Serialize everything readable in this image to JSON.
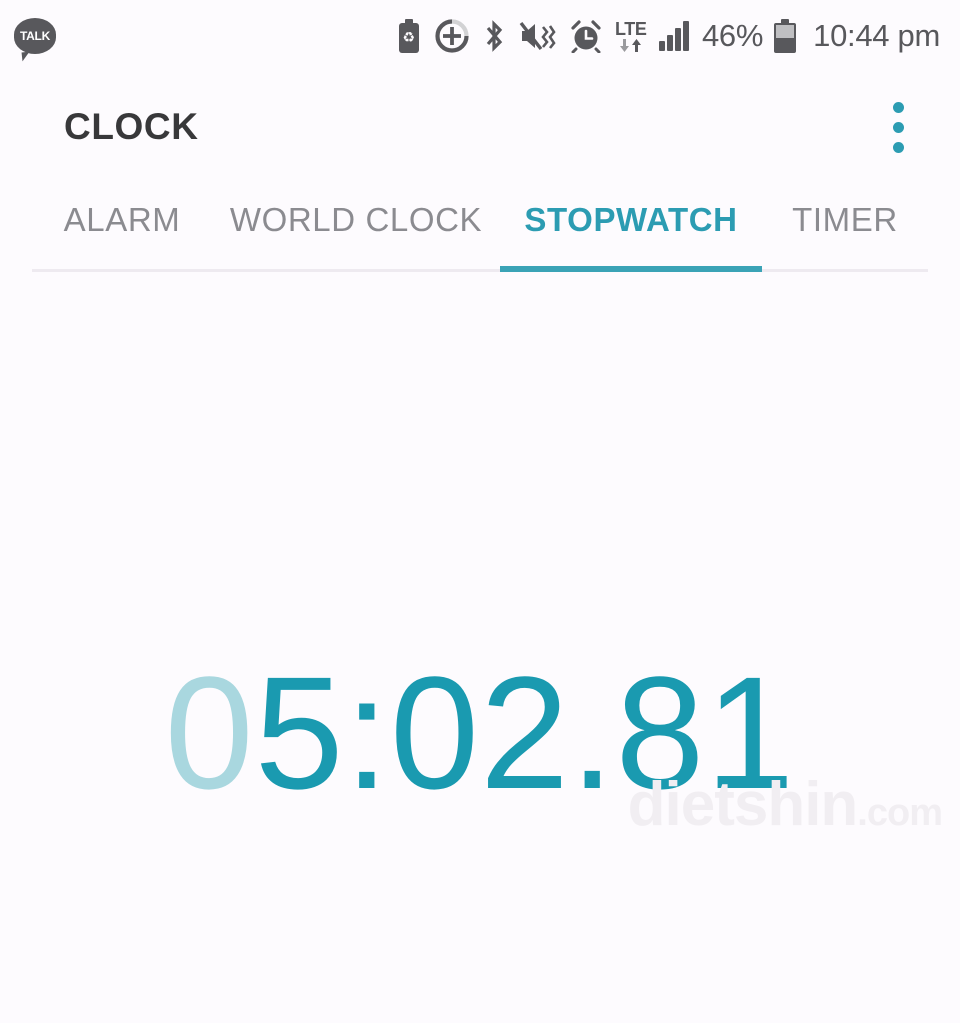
{
  "status_bar": {
    "notification_icon": "kakaotalk-icon",
    "notification_label": "TALK",
    "icons": [
      "battery-saver-icon",
      "data-saver-circle-plus-icon",
      "bluetooth-icon",
      "mute-vibrate-icon",
      "alarm-icon",
      "lte-network-icon",
      "signal-bars-icon"
    ],
    "lte_label": "LTE",
    "battery_percent": "46%",
    "battery_icon": "battery-icon",
    "clock": "10:44 pm"
  },
  "app_bar": {
    "title": "CLOCK",
    "overflow_icon": "overflow-menu-icon"
  },
  "tabs": [
    {
      "label": "ALARM",
      "active": false
    },
    {
      "label": "WORLD CLOCK",
      "active": false
    },
    {
      "label": "STOPWATCH",
      "active": true
    },
    {
      "label": "TIMER",
      "active": false
    }
  ],
  "stopwatch": {
    "elapsed": "05:02.81",
    "leading_zero": "0",
    "remainder": "5:02.81"
  },
  "watermark": {
    "name": "dietshin",
    "domain": ".com"
  },
  "colors": {
    "accent_teal": "#2c9cb2",
    "time_teal": "#1a9ab0",
    "time_faded": "#a9d7df",
    "status_gray": "#58585c",
    "tab_inactive": "#8b8b90",
    "title_dark": "#38383a",
    "background": "#fdfbfe"
  }
}
